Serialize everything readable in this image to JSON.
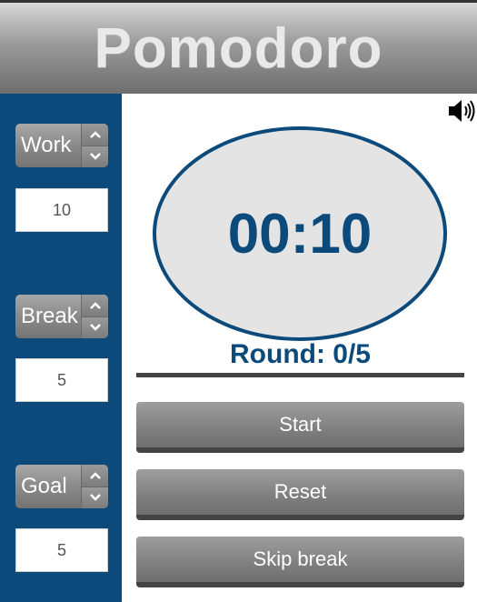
{
  "header": {
    "title": "Pomodoro"
  },
  "sidebar": {
    "work": {
      "label": "Work",
      "value": "10"
    },
    "break": {
      "label": "Break",
      "value": "5"
    },
    "goal": {
      "label": "Goal",
      "value": "5"
    }
  },
  "sound": {
    "icon": "speaker-volume-icon"
  },
  "timer": {
    "display": "00:10"
  },
  "round": {
    "text": "Round: 0/5"
  },
  "buttons": {
    "start": "Start",
    "reset": "Reset",
    "skip_break": "Skip break"
  },
  "colors": {
    "accent": "#0b4a7b",
    "header_gradient_top": "#d8d8d8",
    "header_gradient_bottom": "#6e6e6e",
    "button_gray": "#8a8a8a",
    "clock_fill": "#e4e4e4"
  }
}
